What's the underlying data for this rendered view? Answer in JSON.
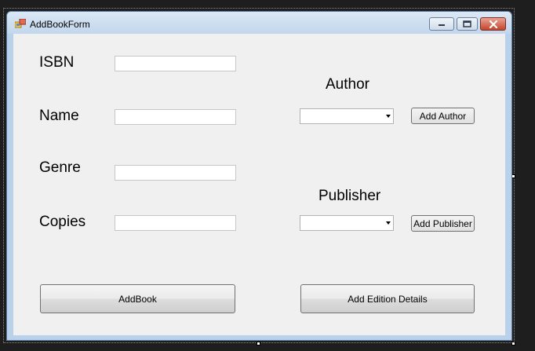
{
  "window": {
    "title": "AddBookForm"
  },
  "fields": {
    "isbn": {
      "label": "ISBN",
      "value": ""
    },
    "name": {
      "label": "Name",
      "value": ""
    },
    "genre": {
      "label": "Genre",
      "value": ""
    },
    "copies": {
      "label": "Copies",
      "value": ""
    }
  },
  "author": {
    "label": "Author",
    "selected": "",
    "add_button": "Add Author"
  },
  "publisher": {
    "label": "Publisher",
    "selected": "",
    "add_button": "Add Publisher"
  },
  "buttons": {
    "add_book": "AddBook",
    "add_edition": "Add Edition Details"
  },
  "colors": {
    "client_bg": "#f0f0f0",
    "frame_bg": "#b9d1ea",
    "close_red": "#c4452c"
  },
  "icons": [
    "form-icon",
    "minimize-icon",
    "maximize-icon",
    "close-icon"
  ]
}
